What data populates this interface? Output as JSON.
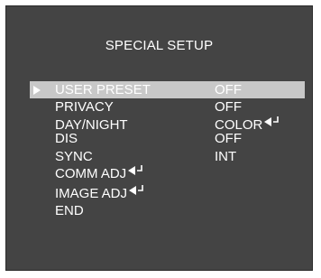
{
  "menu": {
    "title": "SPECIAL SETUP",
    "items": [
      {
        "label": "USER PRESET",
        "value": "OFF",
        "selected": true
      },
      {
        "label": "PRIVACY",
        "value": "OFF"
      },
      {
        "label": "DAY/NIGHT",
        "value": "COLOR",
        "value_icon": "enter-icon"
      },
      {
        "label": "DIS",
        "value": "OFF"
      },
      {
        "label": "SYNC",
        "value": "INT"
      },
      {
        "label": "COMM ADJ",
        "label_icon": "enter-icon"
      },
      {
        "label": "IMAGE ADJ",
        "label_icon": "enter-icon"
      },
      {
        "label": "END"
      }
    ]
  },
  "colors": {
    "background": "#444444",
    "highlight": "#c8c8c8",
    "text": "#ffffff"
  },
  "icons": {
    "cursor": "triangle-right-icon",
    "enter": "enter-icon"
  }
}
